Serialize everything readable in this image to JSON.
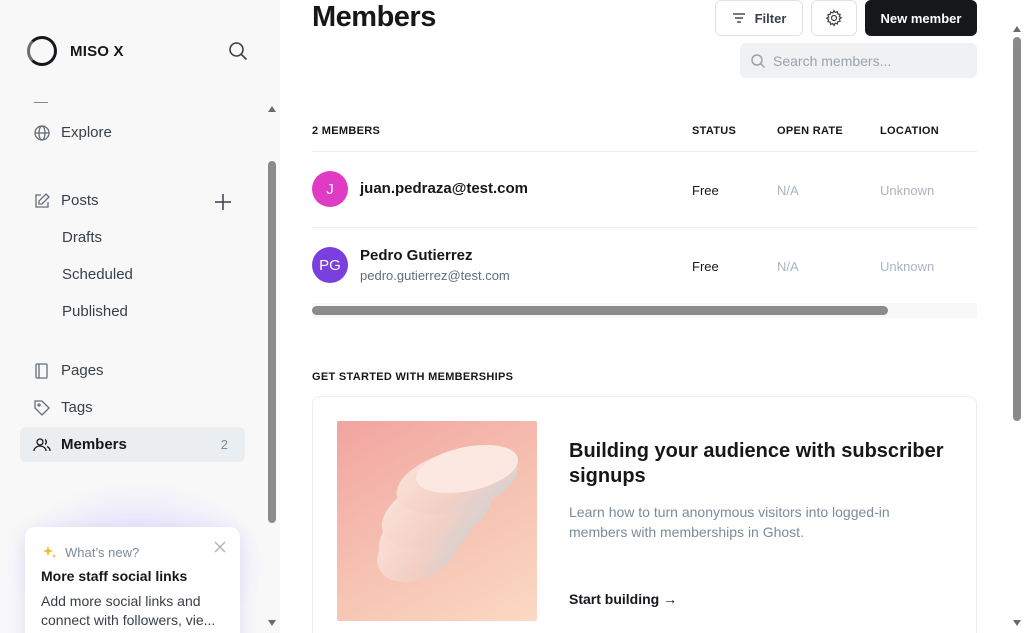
{
  "sidebar": {
    "brand": "MISO X",
    "items": [
      {
        "label": "Explore",
        "icon": "globe-icon"
      },
      {
        "label": "Posts",
        "icon": "edit-icon"
      },
      {
        "label": "Drafts"
      },
      {
        "label": "Scheduled"
      },
      {
        "label": "Published"
      },
      {
        "label": "Pages",
        "icon": "pages-icon"
      },
      {
        "label": "Tags",
        "icon": "tag-icon"
      },
      {
        "label": "Members",
        "icon": "members-icon",
        "count": "2"
      }
    ],
    "whats_new": {
      "heading": "What’s new?",
      "title": "More staff social links",
      "body": "Add more social links and connect with followers, vie..."
    }
  },
  "header": {
    "title": "Members",
    "filter_label": "Filter",
    "new_member_label": "New member",
    "search_placeholder": "Search members..."
  },
  "table": {
    "columns": [
      "2 MEMBERS",
      "STATUS",
      "OPEN RATE",
      "LOCATION"
    ],
    "rows": [
      {
        "initials": "J",
        "name": "juan.pedraza@test.com",
        "email": "",
        "status": "Free",
        "open_rate": "N/A",
        "location": "Unknown",
        "color": "#e03bc5"
      },
      {
        "initials": "PG",
        "name": "Pedro Gutierrez",
        "email": "pedro.gutierrez@test.com",
        "status": "Free",
        "open_rate": "N/A",
        "location": "Unknown",
        "color": "#7b3fe0"
      }
    ]
  },
  "get_started": {
    "section_title": "GET STARTED WITH MEMBERSHIPS",
    "card_title": "Building your audience with subscriber signups",
    "card_desc": "Learn how to turn anonymous visitors into logged-in members with memberships in Ghost.",
    "card_link": "Start building →"
  }
}
